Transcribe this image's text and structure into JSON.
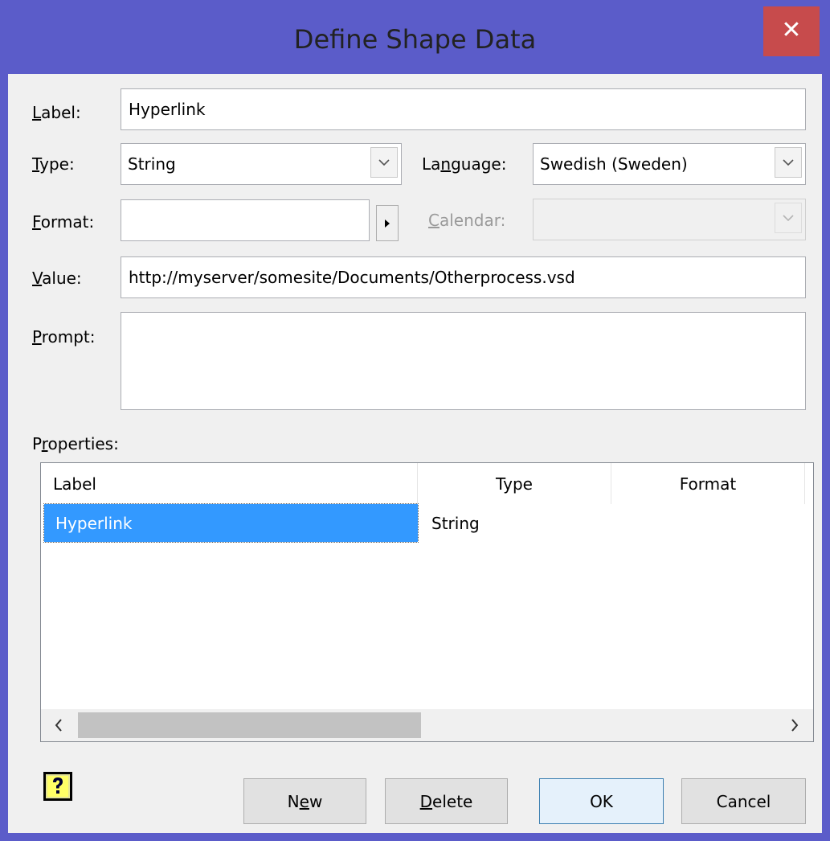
{
  "window": {
    "title": "Define Shape Data",
    "close_label": "✕",
    "frame_color": "#5b5cc9",
    "close_color": "#c74b4c"
  },
  "form": {
    "label": {
      "accel": "L",
      "rest": "abel:",
      "value": "Hyperlink"
    },
    "type": {
      "accel": "T",
      "rest": "ype:",
      "value": "String"
    },
    "language": {
      "pre": "La",
      "accel": "n",
      "rest": "guage:",
      "value": "Swedish (Sweden)"
    },
    "format": {
      "accel": "F",
      "rest": "ormat:",
      "value": ""
    },
    "calendar": {
      "accel": "C",
      "rest": "alendar:",
      "value": ""
    },
    "value": {
      "accel": "V",
      "rest": "alue:",
      "value": "http://myserver/somesite/Documents/Otherprocess.vsd"
    },
    "prompt": {
      "accel": "P",
      "rest": "rompt:",
      "value": ""
    }
  },
  "properties": {
    "pre": "P",
    "accel": "r",
    "rest": "operties:",
    "columns": [
      "Label",
      "Type",
      "Format"
    ],
    "rows": [
      {
        "label": "Hyperlink",
        "type": "String",
        "format": ""
      }
    ],
    "selection_color": "#3399ff"
  },
  "buttons": {
    "new": {
      "pre": "N",
      "accel": "e",
      "rest": "w"
    },
    "delete": {
      "pre": "",
      "accel": "D",
      "rest": "elete"
    },
    "ok": "OK",
    "cancel": "Cancel"
  },
  "icons": {
    "help": "help-icon",
    "dropdown": "chevron-down-icon",
    "format_arrow": "triangle-right-icon",
    "scroll_left": "chevron-left-icon",
    "scroll_right": "chevron-right-icon"
  }
}
